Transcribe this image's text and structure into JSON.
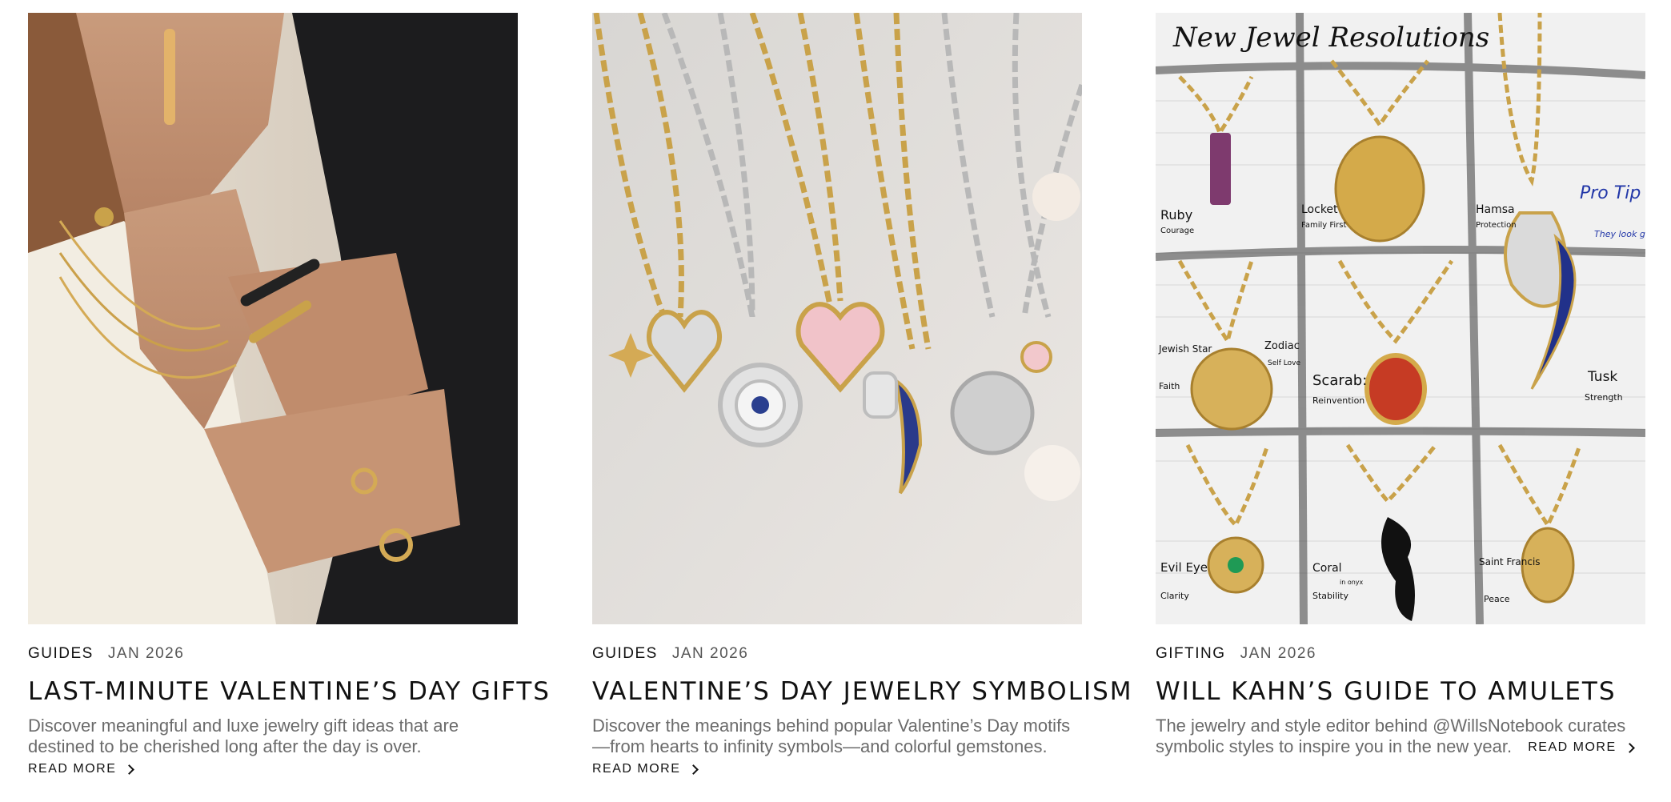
{
  "cards": [
    {
      "category": "GUIDES",
      "date": "JAN 2026",
      "title": "LAST-MINUTE VALENTINE’S DAY GIFTS",
      "description": "Discover meaningful and luxe jewelry gift ideas that are destined to be cherished long after the day is over.",
      "read_more": "READ MORE"
    },
    {
      "category": "GUIDES",
      "date": "JAN 2026",
      "title": "VALENTINE’S DAY JEWELRY SYMBOLISM",
      "description": "Discover the meanings behind popular Valentine’s Day motifs—from hearts to infinity symbols—and colorful gemstones.",
      "read_more": "READ MORE"
    },
    {
      "category": "GIFTING",
      "date": "JAN 2026",
      "title": "WILL KAHN’S GUIDE TO AMULETS",
      "description": "The jewelry and style editor behind @WillsNotebook curates symbolic styles to inspire you in the new year.",
      "read_more": "READ MORE",
      "image_text": {
        "heading": "New Jewel Resolutions",
        "labels": [
          "Ruby",
          "Courage",
          "Locket",
          "Family First",
          "Hamsa",
          "Protection",
          "Pro Tip",
          "They look great in Groups",
          "Jewish Star",
          "Faith",
          "Zodiac",
          "Self Love",
          "Scarab:",
          "Reinvention",
          "Tusk",
          "Strength",
          "Evil Eye",
          "Clarity",
          "Coral",
          "in onyx",
          "Stability",
          "Saint Francis",
          "Peace"
        ]
      }
    }
  ],
  "colors": {
    "gold": "#c9a24a",
    "silver": "#b8b8b8",
    "text": "#111111",
    "muted": "#6b6b6b"
  }
}
